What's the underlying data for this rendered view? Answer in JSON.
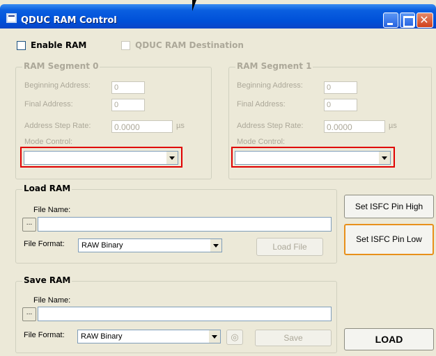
{
  "window": {
    "title": "QDUC RAM Control"
  },
  "top": {
    "enable_ram": "Enable RAM",
    "qduc_dest": "QDUC RAM Destination"
  },
  "seg0": {
    "title": "RAM Segment 0",
    "begin_label": "Beginning Address:",
    "begin_value": "0",
    "final_label": "Final Address:",
    "final_value": "0",
    "step_label": "Address Step Rate:",
    "step_value": "0.0000",
    "step_unit": "µs",
    "mode_label": "Mode Control:",
    "mode_value": ""
  },
  "seg1": {
    "title": "RAM Segment 1",
    "begin_label": "Beginning Address:",
    "begin_value": "0",
    "final_label": "Final Address:",
    "final_value": "0",
    "step_label": "Address Step Rate:",
    "step_value": "0.0000",
    "step_unit": "µs",
    "mode_label": "Mode Control:",
    "mode_value": ""
  },
  "load": {
    "title": "Load RAM",
    "file_name_label": "File Name:",
    "file_name_value": "",
    "browse": "...",
    "format_label": "File Format:",
    "format_value": "RAW Binary",
    "load_file": "Load File"
  },
  "save": {
    "title": "Save RAM",
    "file_name_label": "File Name:",
    "file_name_value": "",
    "browse": "...",
    "format_label": "File Format:",
    "format_value": "RAW Binary",
    "save": "Save"
  },
  "side": {
    "set_high": "Set ISFC Pin High",
    "set_low": "Set ISFC Pin Low",
    "load": "LOAD"
  }
}
